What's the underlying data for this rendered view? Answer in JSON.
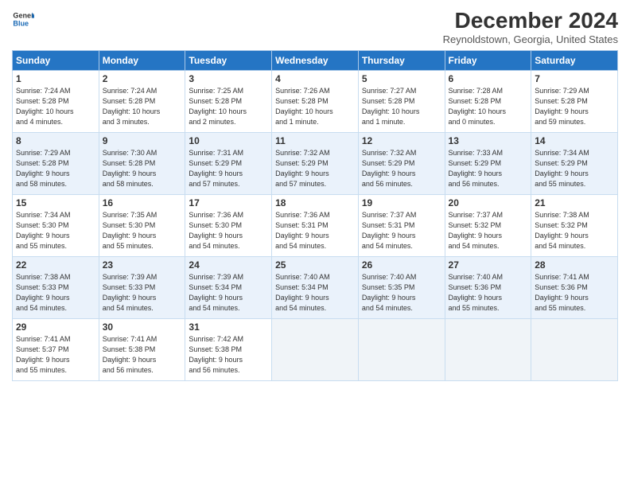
{
  "logo": {
    "line1": "General",
    "line2": "Blue"
  },
  "title": "December 2024",
  "location": "Reynoldstown, Georgia, United States",
  "headers": [
    "Sunday",
    "Monday",
    "Tuesday",
    "Wednesday",
    "Thursday",
    "Friday",
    "Saturday"
  ],
  "weeks": [
    [
      {
        "day": "1",
        "info": "Sunrise: 7:24 AM\nSunset: 5:28 PM\nDaylight: 10 hours\nand 4 minutes."
      },
      {
        "day": "2",
        "info": "Sunrise: 7:24 AM\nSunset: 5:28 PM\nDaylight: 10 hours\nand 3 minutes."
      },
      {
        "day": "3",
        "info": "Sunrise: 7:25 AM\nSunset: 5:28 PM\nDaylight: 10 hours\nand 2 minutes."
      },
      {
        "day": "4",
        "info": "Sunrise: 7:26 AM\nSunset: 5:28 PM\nDaylight: 10 hours\nand 1 minute."
      },
      {
        "day": "5",
        "info": "Sunrise: 7:27 AM\nSunset: 5:28 PM\nDaylight: 10 hours\nand 1 minute."
      },
      {
        "day": "6",
        "info": "Sunrise: 7:28 AM\nSunset: 5:28 PM\nDaylight: 10 hours\nand 0 minutes."
      },
      {
        "day": "7",
        "info": "Sunrise: 7:29 AM\nSunset: 5:28 PM\nDaylight: 9 hours\nand 59 minutes."
      }
    ],
    [
      {
        "day": "8",
        "info": "Sunrise: 7:29 AM\nSunset: 5:28 PM\nDaylight: 9 hours\nand 58 minutes."
      },
      {
        "day": "9",
        "info": "Sunrise: 7:30 AM\nSunset: 5:28 PM\nDaylight: 9 hours\nand 58 minutes."
      },
      {
        "day": "10",
        "info": "Sunrise: 7:31 AM\nSunset: 5:29 PM\nDaylight: 9 hours\nand 57 minutes."
      },
      {
        "day": "11",
        "info": "Sunrise: 7:32 AM\nSunset: 5:29 PM\nDaylight: 9 hours\nand 57 minutes."
      },
      {
        "day": "12",
        "info": "Sunrise: 7:32 AM\nSunset: 5:29 PM\nDaylight: 9 hours\nand 56 minutes."
      },
      {
        "day": "13",
        "info": "Sunrise: 7:33 AM\nSunset: 5:29 PM\nDaylight: 9 hours\nand 56 minutes."
      },
      {
        "day": "14",
        "info": "Sunrise: 7:34 AM\nSunset: 5:29 PM\nDaylight: 9 hours\nand 55 minutes."
      }
    ],
    [
      {
        "day": "15",
        "info": "Sunrise: 7:34 AM\nSunset: 5:30 PM\nDaylight: 9 hours\nand 55 minutes."
      },
      {
        "day": "16",
        "info": "Sunrise: 7:35 AM\nSunset: 5:30 PM\nDaylight: 9 hours\nand 55 minutes."
      },
      {
        "day": "17",
        "info": "Sunrise: 7:36 AM\nSunset: 5:30 PM\nDaylight: 9 hours\nand 54 minutes."
      },
      {
        "day": "18",
        "info": "Sunrise: 7:36 AM\nSunset: 5:31 PM\nDaylight: 9 hours\nand 54 minutes."
      },
      {
        "day": "19",
        "info": "Sunrise: 7:37 AM\nSunset: 5:31 PM\nDaylight: 9 hours\nand 54 minutes."
      },
      {
        "day": "20",
        "info": "Sunrise: 7:37 AM\nSunset: 5:32 PM\nDaylight: 9 hours\nand 54 minutes."
      },
      {
        "day": "21",
        "info": "Sunrise: 7:38 AM\nSunset: 5:32 PM\nDaylight: 9 hours\nand 54 minutes."
      }
    ],
    [
      {
        "day": "22",
        "info": "Sunrise: 7:38 AM\nSunset: 5:33 PM\nDaylight: 9 hours\nand 54 minutes."
      },
      {
        "day": "23",
        "info": "Sunrise: 7:39 AM\nSunset: 5:33 PM\nDaylight: 9 hours\nand 54 minutes."
      },
      {
        "day": "24",
        "info": "Sunrise: 7:39 AM\nSunset: 5:34 PM\nDaylight: 9 hours\nand 54 minutes."
      },
      {
        "day": "25",
        "info": "Sunrise: 7:40 AM\nSunset: 5:34 PM\nDaylight: 9 hours\nand 54 minutes."
      },
      {
        "day": "26",
        "info": "Sunrise: 7:40 AM\nSunset: 5:35 PM\nDaylight: 9 hours\nand 54 minutes."
      },
      {
        "day": "27",
        "info": "Sunrise: 7:40 AM\nSunset: 5:36 PM\nDaylight: 9 hours\nand 55 minutes."
      },
      {
        "day": "28",
        "info": "Sunrise: 7:41 AM\nSunset: 5:36 PM\nDaylight: 9 hours\nand 55 minutes."
      }
    ],
    [
      {
        "day": "29",
        "info": "Sunrise: 7:41 AM\nSunset: 5:37 PM\nDaylight: 9 hours\nand 55 minutes."
      },
      {
        "day": "30",
        "info": "Sunrise: 7:41 AM\nSunset: 5:38 PM\nDaylight: 9 hours\nand 56 minutes."
      },
      {
        "day": "31",
        "info": "Sunrise: 7:42 AM\nSunset: 5:38 PM\nDaylight: 9 hours\nand 56 minutes."
      },
      {
        "day": "",
        "info": ""
      },
      {
        "day": "",
        "info": ""
      },
      {
        "day": "",
        "info": ""
      },
      {
        "day": "",
        "info": ""
      }
    ]
  ]
}
